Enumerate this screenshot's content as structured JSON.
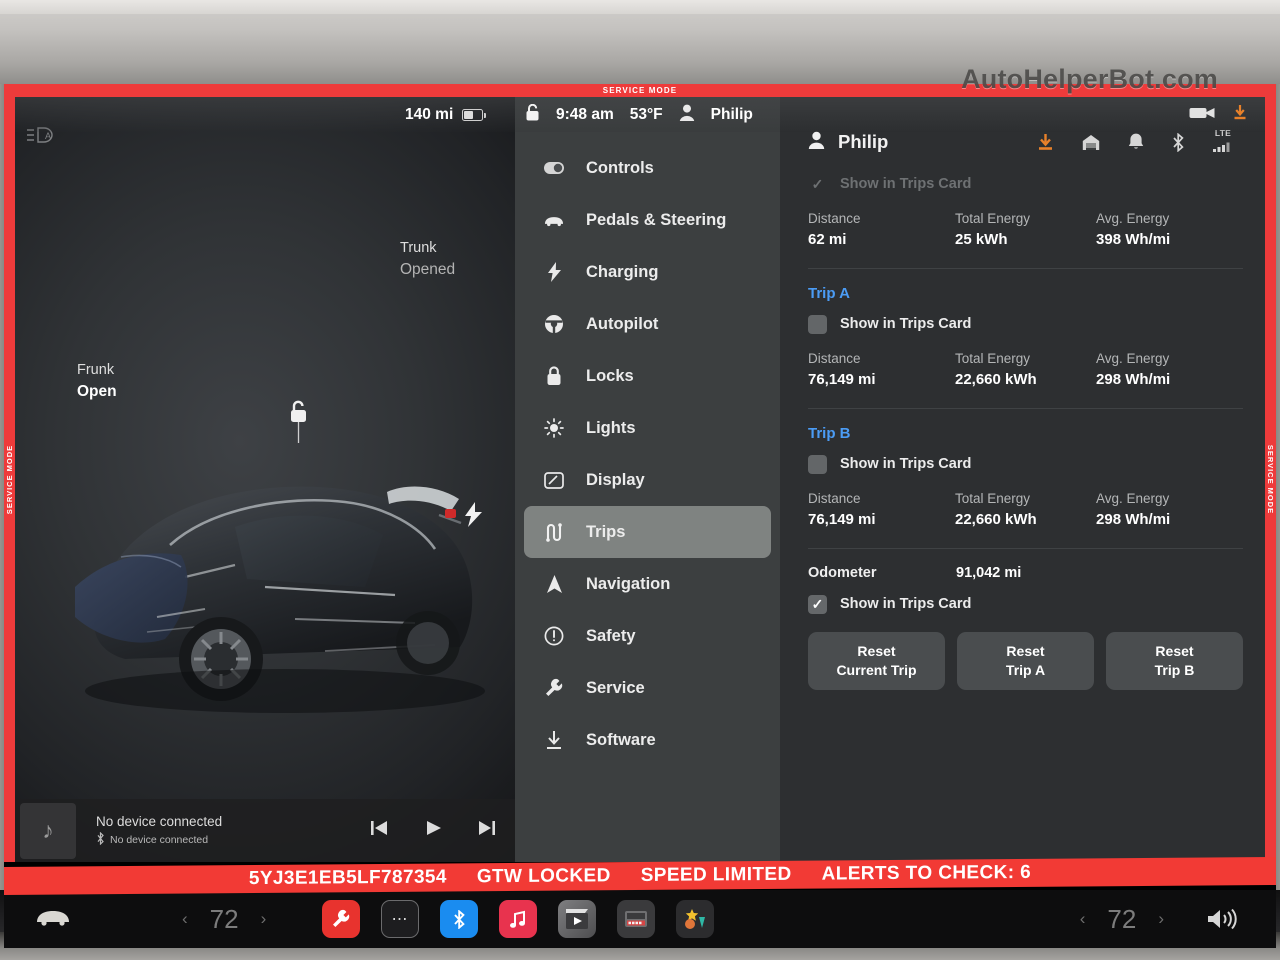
{
  "watermark": "AutoHelperBot.com",
  "service_mode": {
    "top_label": "SERVICE MODE",
    "left_label": "SERVICE MODE",
    "right_label": "SERVICE MODE",
    "bottom_items": [
      "5YJ3E1EB5LF787354",
      "GTW LOCKED",
      "SPEED LIMITED",
      "ALERTS TO CHECK: 6"
    ],
    "border_color": "#ee3b3b"
  },
  "topbar": {
    "range": "140 mi",
    "time": "9:48 am",
    "temperature": "53°F",
    "driver": "Philip",
    "lock_icon": "unlock-icon",
    "person_icon": "person-icon",
    "dashcam_icon": "dashcam-icon",
    "download_icon": "download-icon"
  },
  "car_view": {
    "auto_lights_icon": "auto-headlight-icon",
    "frunk": {
      "label": "Frunk",
      "state": "Open"
    },
    "trunk": {
      "label": "Trunk",
      "state": "Opened"
    },
    "lock_icon": "unlocked-padlock-icon",
    "charge_icon": "charge-bolt-icon"
  },
  "media": {
    "title": "No device connected",
    "subtitle": "No device connected",
    "bluetooth_icon": "bluetooth-icon",
    "prev_icon": "previous-track-icon",
    "play_icon": "play-icon",
    "next_icon": "next-track-icon",
    "art_icon": "music-note-icon"
  },
  "menu": {
    "items": [
      {
        "label": "Controls",
        "icon": "toggle-switch-icon",
        "active": false
      },
      {
        "label": "Pedals & Steering",
        "icon": "car-icon",
        "active": false
      },
      {
        "label": "Charging",
        "icon": "bolt-icon",
        "active": false
      },
      {
        "label": "Autopilot",
        "icon": "steering-wheel-icon",
        "active": false
      },
      {
        "label": "Locks",
        "icon": "padlock-icon",
        "active": false
      },
      {
        "label": "Lights",
        "icon": "sun-icon",
        "active": false
      },
      {
        "label": "Display",
        "icon": "screen-icon",
        "active": false
      },
      {
        "label": "Trips",
        "icon": "trips-route-icon",
        "active": true
      },
      {
        "label": "Navigation",
        "icon": "navigation-arrow-icon",
        "active": false
      },
      {
        "label": "Safety",
        "icon": "exclamation-circle-icon",
        "active": false
      },
      {
        "label": "Service",
        "icon": "wrench-icon",
        "active": false
      },
      {
        "label": "Software",
        "icon": "download-icon",
        "active": false
      }
    ]
  },
  "content": {
    "profile_name": "Philip",
    "status_icons": {
      "download": "download-icon",
      "home": "home-garage-icon",
      "bell": "bell-icon",
      "bluetooth": "bluetooth-icon",
      "network_label": "LTE",
      "signal": "signal-bars-icon"
    },
    "labels": {
      "distance": "Distance",
      "total_energy": "Total Energy",
      "avg_energy": "Avg. Energy",
      "show_in_trips_card": "Show in Trips Card",
      "odometer": "Odometer"
    },
    "current_trip": {
      "show_in_trips_card": true,
      "distance": "62 mi",
      "total_energy": "25 kWh",
      "avg_energy": "398 Wh/mi"
    },
    "trip_a": {
      "title": "Trip A",
      "show_in_trips_card": false,
      "distance": "76,149 mi",
      "total_energy": "22,660 kWh",
      "avg_energy": "298 Wh/mi"
    },
    "trip_b": {
      "title": "Trip B",
      "show_in_trips_card": false,
      "distance": "76,149 mi",
      "total_energy": "22,660 kWh",
      "avg_energy": "298 Wh/mi"
    },
    "odometer": {
      "value": "91,042 mi",
      "show_in_trips_card": true
    },
    "buttons": [
      {
        "line1": "Reset",
        "line2": "Current Trip"
      },
      {
        "line1": "Reset",
        "line2": "Trip A"
      },
      {
        "line1": "Reset",
        "line2": "Trip B"
      }
    ],
    "accent_color": "#4b9cf5"
  },
  "taskbar": {
    "car_icon": "car-icon",
    "temp_left": "72",
    "temp_right": "72",
    "prev_chevron": "‹",
    "next_chevron": "›",
    "apps": [
      {
        "name": "service-app",
        "icon": "wrench-icon"
      },
      {
        "name": "more-apps",
        "icon": "ellipsis-icon"
      },
      {
        "name": "bluetooth-app",
        "icon": "bluetooth-icon"
      },
      {
        "name": "music-app",
        "icon": "music-note-icon"
      },
      {
        "name": "theater-app",
        "icon": "clapperboard-icon"
      },
      {
        "name": "arcade-app",
        "icon": "arcade-icon"
      },
      {
        "name": "toybox-app",
        "icon": "toybox-icon"
      }
    ],
    "volume_icon": "speaker-icon"
  }
}
